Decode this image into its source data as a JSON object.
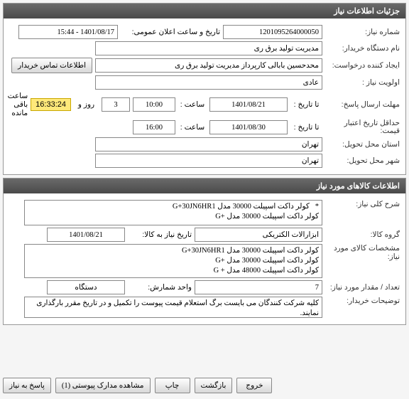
{
  "panel1": {
    "title": "جزئیات اطلاعات نیاز"
  },
  "need": {
    "number_label": "شماره نیاز:",
    "number": "1201095264000050",
    "announce_label": "تاریخ و ساعت اعلان عمومی:",
    "announce_value": "1401/08/17 - 15:44",
    "buyer_label": "نام دستگاه خریدار:",
    "buyer": "مدیریت تولید برق ری",
    "requester_label": "ایجاد کننده درخواست:",
    "requester": "محدحسین بابالی کارپرداز مدیریت تولید برق ری",
    "contact_btn": "اطلاعات تماس خریدار",
    "priority_label": "اولویت نیاز :",
    "priority": "عادی",
    "deadline_label": "مهلت ارسال پاسخ:",
    "to_date_lbl": "تا تاریخ :",
    "deadline_date": "1401/08/21",
    "hour_lbl": "ساعت :",
    "deadline_time": "10:00",
    "days": "3",
    "days_lbl": "روز و",
    "remaining_time": "16:33:24",
    "remaining_lbl": "ساعت باقی مانده",
    "price_validity_label": "حداقل تاریخ اعتبار\nقیمت:",
    "price_date": "1401/08/30",
    "price_time": "16:00",
    "province_label": "استان محل تحویل:",
    "province": "تهران",
    "city_label": "شهر محل تحویل:",
    "city": "تهران"
  },
  "panel2": {
    "title": "اطلاعات کالاهای مورد نیاز"
  },
  "goods": {
    "desc_label": "شرح کلی نیاز:",
    "desc": "*   کولر داکت اسپیلت 30000 مدل G+30JN6HR1\nکولر داکت اسپیلت 30000 مدل +G",
    "group_label": "گروه کالا:",
    "group": "ابزارالات الکتریکی",
    "need_date_label": "تاریخ نیاز به کالا:",
    "need_date": "1401/08/21",
    "spec_label": "مشخصات کالای مورد نیاز:",
    "spec": "کولر داکت اسپیلت 30000 مدل G+30JN6HR1\nکولر داکت اسپیلت 30000 مدل +G\nکولر داکت اسپیلت 48000 مدل + G",
    "qty_label": "تعداد / مقدار مورد نیاز:",
    "qty": "7",
    "unit_label": "واحد شمارش:",
    "unit": "دستگاه",
    "buyer_note_label": "توضیحات خریدار:",
    "buyer_note": "کلیه شرکت کنندگان می بایست برگ استعلام قیمت پیوست را تکمیل و در تاریخ مقرر بارگذاری نمایند."
  },
  "footer": {
    "reply": "پاسخ به نیاز",
    "attach": "مشاهده مدارک پیوستی (1)",
    "print": "چاپ",
    "back": "بازگشت",
    "exit": "خروج"
  }
}
